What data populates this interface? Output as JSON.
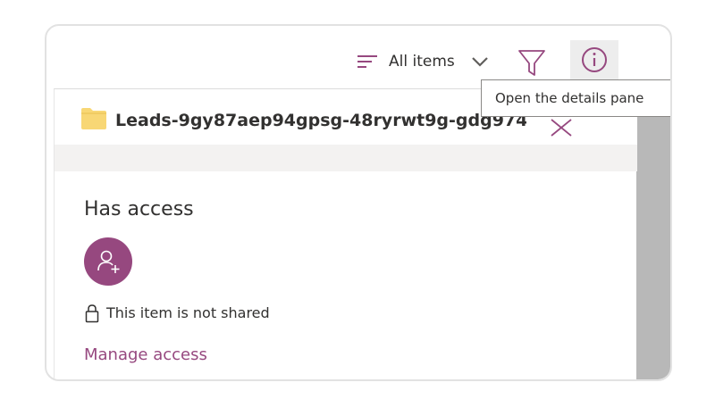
{
  "toolbar": {
    "view_label": "All items",
    "view_icon": "list-lines-icon",
    "chevron_icon": "chevron-down-icon",
    "filter_icon": "filter-icon",
    "info_icon": "info-icon",
    "tooltip": "Open the details pane"
  },
  "file": {
    "name": "Leads-9gy87aep94gpsg-48ryrwt9g-gdg974...",
    "icon": "folder-icon",
    "close_icon": "close-icon"
  },
  "access": {
    "title": "Has access",
    "avatar_icon": "add-person-icon",
    "status_icon": "lock-icon",
    "status_text": "This item is not shared",
    "manage_link": "Manage access"
  },
  "colors": {
    "accent": "#96487f",
    "folder": "#f8d775",
    "scroll_track": "#b8b8b8"
  }
}
